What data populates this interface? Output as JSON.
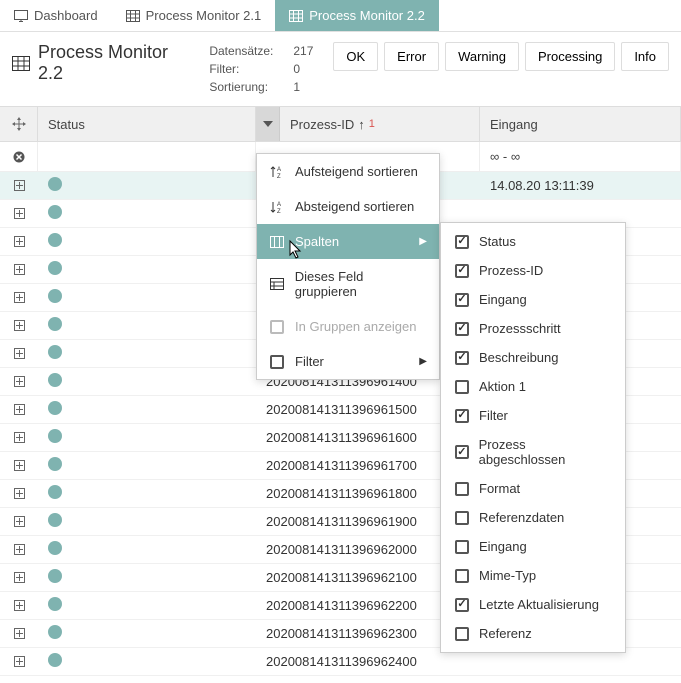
{
  "tabs": [
    {
      "label": "Dashboard"
    },
    {
      "label": "Process Monitor 2.1"
    },
    {
      "label": "Process Monitor 2.2"
    }
  ],
  "page_title": "Process Monitor 2.2",
  "meta": {
    "datensatze_label": "Datensätze:",
    "datensatze_value": "217",
    "filter_label": "Filter:",
    "filter_value": "0",
    "sortierung_label": "Sortierung:",
    "sortierung_value": "1"
  },
  "filter_buttons": [
    "OK",
    "Error",
    "Warning",
    "Processing",
    "Info"
  ],
  "columns": {
    "status": "Status",
    "prozess_id": "Prozess-ID",
    "sort_indicator": "1",
    "eingang": "Eingang"
  },
  "filter_eingang": "∞ - ∞",
  "rows": [
    {
      "pid": "",
      "eingang": "14.08.20 13:11:39",
      "highlight": true
    },
    {
      "pid": "",
      "eingang": ""
    },
    {
      "pid": "",
      "eingang": ""
    },
    {
      "pid": "",
      "eingang": ""
    },
    {
      "pid": "",
      "eingang": ""
    },
    {
      "pid": "",
      "eingang": ""
    },
    {
      "pid": "",
      "eingang": ""
    },
    {
      "pid": "202008141311396961400",
      "eingang": ""
    },
    {
      "pid": "202008141311396961500",
      "eingang": ""
    },
    {
      "pid": "202008141311396961600",
      "eingang": ""
    },
    {
      "pid": "202008141311396961700",
      "eingang": ""
    },
    {
      "pid": "202008141311396961800",
      "eingang": ""
    },
    {
      "pid": "202008141311396961900",
      "eingang": ""
    },
    {
      "pid": "202008141311396962000",
      "eingang": ""
    },
    {
      "pid": "202008141311396962100",
      "eingang": ""
    },
    {
      "pid": "202008141311396962200",
      "eingang": ""
    },
    {
      "pid": "202008141311396962300",
      "eingang": ""
    },
    {
      "pid": "202008141311396962400",
      "eingang": ""
    }
  ],
  "ctx_menu": {
    "sort_asc": "Aufsteigend sortieren",
    "sort_desc": "Absteigend sortieren",
    "columns": "Spalten",
    "group_by": "Dieses Feld gruppieren",
    "show_groups": "In Gruppen anzeigen",
    "filter": "Filter"
  },
  "submenu": [
    {
      "label": "Status",
      "checked": true
    },
    {
      "label": "Prozess-ID",
      "checked": true
    },
    {
      "label": "Eingang",
      "checked": true
    },
    {
      "label": "Prozessschritt",
      "checked": true
    },
    {
      "label": "Beschreibung",
      "checked": true
    },
    {
      "label": "Aktion 1",
      "checked": false
    },
    {
      "label": "Filter",
      "checked": true
    },
    {
      "label": "Prozess abgeschlossen",
      "checked": true
    },
    {
      "label": "Format",
      "checked": false
    },
    {
      "label": "Referenzdaten",
      "checked": false
    },
    {
      "label": "Eingang",
      "checked": false
    },
    {
      "label": "Mime-Typ",
      "checked": false
    },
    {
      "label": "Letzte Aktualisierung",
      "checked": true
    },
    {
      "label": "Referenz",
      "checked": false
    }
  ]
}
